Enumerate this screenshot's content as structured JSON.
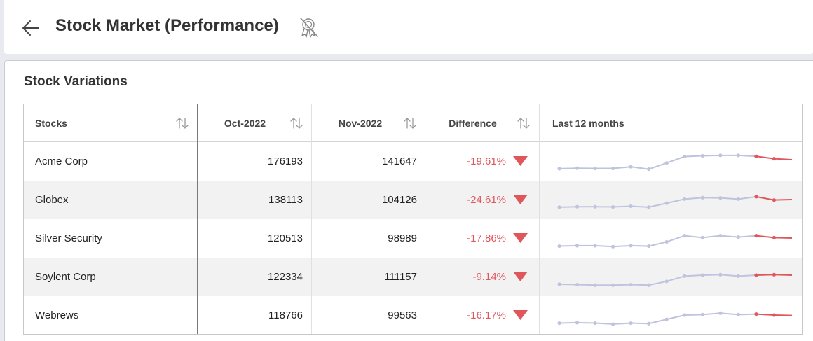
{
  "header": {
    "title": "Stock Market (Performance)",
    "back_icon": "arrow-left-icon",
    "badge_icon": "award-badge-off-icon"
  },
  "card": {
    "title": "Stock Variations"
  },
  "table": {
    "columns": [
      "Stocks",
      "Oct-2022",
      "Nov-2022",
      "Difference",
      "Last 12 months"
    ],
    "rows": [
      {
        "stock": "Acme Corp",
        "oct": "176193",
        "nov": "141647",
        "diff": "-19.61%",
        "trend": [
          0.18,
          0.2,
          0.19,
          0.19,
          0.26,
          0.16,
          0.42,
          0.69,
          0.72,
          0.74,
          0.74,
          0.7,
          0.6,
          0.56
        ]
      },
      {
        "stock": "Globex",
        "oct": "138113",
        "nov": "104126",
        "diff": "-24.61%",
        "trend": [
          0.18,
          0.2,
          0.2,
          0.19,
          0.22,
          0.18,
          0.35,
          0.52,
          0.58,
          0.57,
          0.52,
          0.62,
          0.48,
          0.5
        ]
      },
      {
        "stock": "Silver Security",
        "oct": "120513",
        "nov": "98989",
        "diff": "-17.86%",
        "trend": [
          0.16,
          0.18,
          0.18,
          0.14,
          0.18,
          0.16,
          0.34,
          0.6,
          0.52,
          0.6,
          0.54,
          0.6,
          0.52,
          0.5
        ]
      },
      {
        "stock": "Soylent Corp",
        "oct": "122334",
        "nov": "111157",
        "diff": "-9.14%",
        "trend": [
          0.18,
          0.16,
          0.14,
          0.14,
          0.16,
          0.14,
          0.3,
          0.52,
          0.56,
          0.58,
          0.52,
          0.56,
          0.58,
          0.56
        ]
      },
      {
        "stock": "Webrews",
        "oct": "118766",
        "nov": "99563",
        "diff": "-16.17%",
        "trend": [
          0.16,
          0.18,
          0.16,
          0.12,
          0.16,
          0.14,
          0.32,
          0.5,
          0.52,
          0.58,
          0.52,
          0.54,
          0.5,
          0.48
        ]
      }
    ]
  },
  "colors": {
    "negative": "#e0575b",
    "spark_line": "#bfc3dd",
    "spark_recent": "#e0575b"
  }
}
